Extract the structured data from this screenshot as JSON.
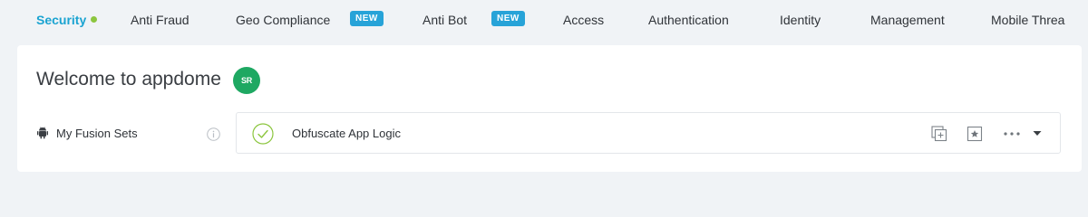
{
  "tabs": [
    {
      "label": "Security",
      "active": true
    },
    {
      "label": "Anti Fraud"
    },
    {
      "label": "Geo Compliance",
      "badge": "NEW"
    },
    {
      "label": "Anti Bot",
      "badge": "NEW"
    },
    {
      "label": "Access"
    },
    {
      "label": "Authentication"
    },
    {
      "label": "Identity"
    },
    {
      "label": "Management"
    },
    {
      "label": "Mobile Threa"
    }
  ],
  "header": {
    "title": "Welcome to appdome",
    "avatar_initials": "SR"
  },
  "fusion": {
    "label": "My Fusion Sets",
    "selected": "Obfuscate App Logic"
  },
  "icons": {
    "platform": "android-icon",
    "info": "info-icon",
    "status": "check-circle-icon",
    "actions": [
      "duplicate-icon",
      "star-icon",
      "more-icon",
      "caret-down-icon"
    ]
  },
  "colors": {
    "active_tab": "#1aa3d1",
    "active_dot": "#8cc63f",
    "badge": "#27a3d8",
    "avatar": "#1ea862",
    "check": "#8cc63f",
    "background": "#f0f3f6"
  }
}
